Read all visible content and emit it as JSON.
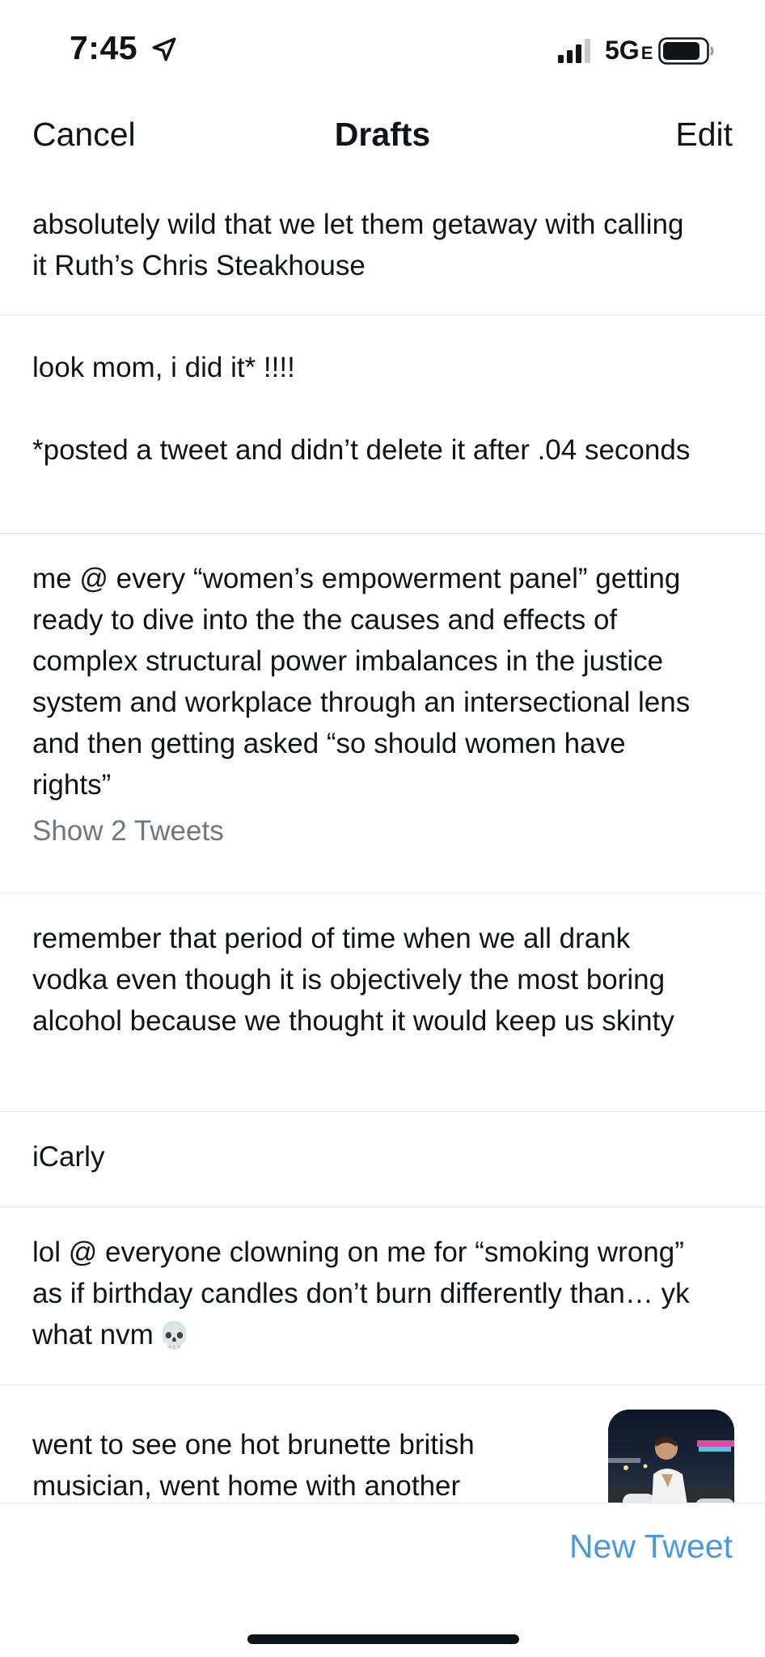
{
  "status_bar": {
    "time": "7:45",
    "network": "5G",
    "network_sub": "E"
  },
  "nav": {
    "cancel_label": "Cancel",
    "title": "Drafts",
    "edit_label": "Edit"
  },
  "drafts": [
    {
      "text": "absolutely wild that we let them getaway with calling\nit Ruth’s Chris Steakhouse"
    },
    {
      "text": "look mom, i did it* !!!!\n\n*posted a tweet and didn’t delete it after .04 seconds"
    },
    {
      "text": "me @ every “women’s empowerment panel” getting\nready to dive into the the causes and effects of\ncomplex structural power imbalances in the justice\nsystem and workplace through an intersectional lens\nand then getting asked “so should women have\nrights”",
      "show_link": "Show 2 Tweets"
    },
    {
      "text": "remember that period of time when we all drank\nvodka even though it is objectively the most boring\nalcohol because we thought it would keep us skinty"
    },
    {
      "text": "iCarly"
    },
    {
      "text": "lol @ everyone clowning on me for “smoking wrong”\nas if birthday candles don’t burn differently than… yk\nwhat nvm",
      "emoji": "💀"
    },
    {
      "text": "went to see one hot brunette british\nmusician, went home with another"
    }
  ],
  "bottom": {
    "new_tweet_label": "New Tweet"
  },
  "colors": {
    "accent": "#4a99e0",
    "muted": "#6b7781",
    "divider": "#e1e6ea",
    "text": "#0f1419"
  },
  "icons": [
    "location-arrow-icon",
    "signal-bars-icon",
    "battery-icon",
    "skull-emoji-icon",
    "photo-thumbnail"
  ]
}
